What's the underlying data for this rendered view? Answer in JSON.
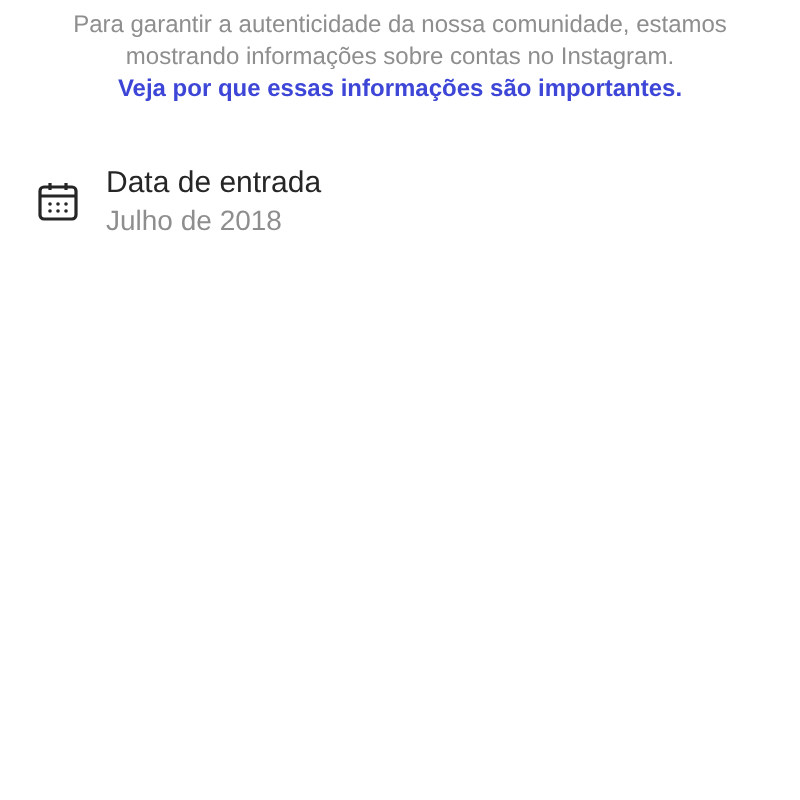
{
  "notice": {
    "text": "Para garantir a autenticidade da nossa comunidade, estamos mostrando informações sobre contas no Instagram.",
    "link": "Veja por que essas informações são importantes."
  },
  "items": [
    {
      "kind": "date",
      "title": "Data de entrada",
      "value": "Julho de 2018"
    }
  ]
}
